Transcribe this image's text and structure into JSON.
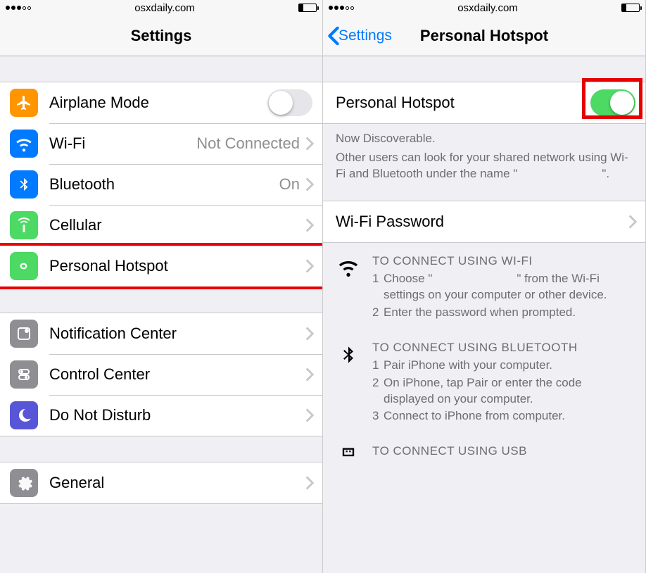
{
  "status": {
    "domain": "osxdaily.com"
  },
  "left": {
    "title": "Settings",
    "rows": {
      "airplane": "Airplane Mode",
      "wifi": "Wi-Fi",
      "wifi_value": "Not Connected",
      "bluetooth": "Bluetooth",
      "bluetooth_value": "On",
      "cellular": "Cellular",
      "hotspot": "Personal Hotspot",
      "notif": "Notification Center",
      "control": "Control Center",
      "dnd": "Do Not Disturb",
      "general": "General"
    }
  },
  "right": {
    "back": "Settings",
    "title": "Personal Hotspot",
    "toggle_label": "Personal Hotspot",
    "discoverable": "Now Discoverable.",
    "discoverable_desc_a": "Other users can look for your shared network using Wi-Fi and Bluetooth under the name \"",
    "discoverable_desc_b": "\".",
    "wifi_password": "Wi-Fi Password",
    "wifi_title": "TO CONNECT USING WI-FI",
    "wifi_step1_a": "Choose \"",
    "wifi_step1_b": "\" from the Wi-Fi settings on your computer or other device.",
    "wifi_step2": "Enter the password when prompted.",
    "bt_title": "TO CONNECT USING BLUETOOTH",
    "bt_step1": "Pair iPhone with your computer.",
    "bt_step2": "On iPhone, tap Pair or enter the code displayed on your computer.",
    "bt_step3": "Connect to iPhone from computer.",
    "usb_title": "TO CONNECT USING USB"
  }
}
